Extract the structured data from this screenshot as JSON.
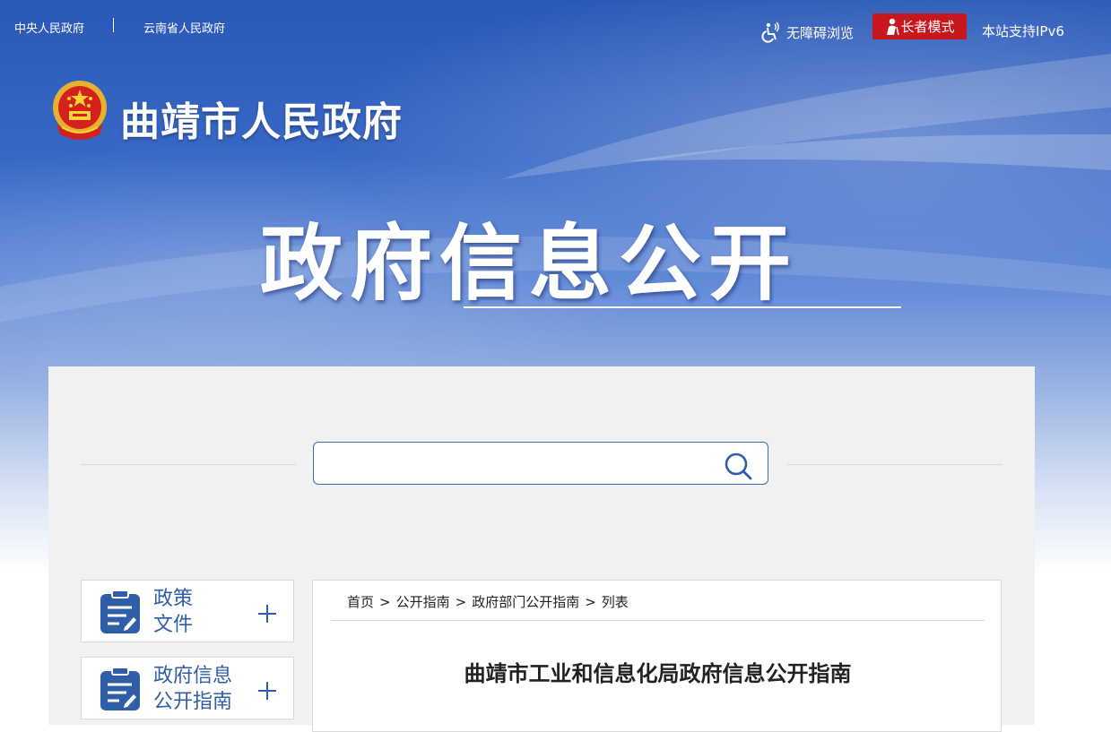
{
  "topbar": {
    "central_gov": "中央人民政府",
    "separator": "|",
    "provincial_gov": "云南省人民政府",
    "accessibility_label": "无障碍浏览",
    "elder_mode_label": "长者模式",
    "ipv6_label": "本站支持IPv6"
  },
  "brand": {
    "site_name": "曲靖市人民政府",
    "section_title": "政府信息公开"
  },
  "search": {
    "placeholder": "",
    "value": ""
  },
  "sidebar": {
    "items": [
      {
        "label_line1": "政策",
        "label_line2": "文件"
      },
      {
        "label_line1": "政府信息",
        "label_line2": "公开指南"
      }
    ]
  },
  "content": {
    "breadcrumb": [
      "首页",
      "公开指南",
      "政府部门公开指南",
      "列表"
    ],
    "breadcrumb_sep": ">",
    "title": "曲靖市工业和信息化局政府信息公开指南"
  },
  "colors": {
    "accent_blue": "#2f5ea8",
    "elder_red": "#c8161d",
    "panel_bg": "#f1f1f1"
  }
}
